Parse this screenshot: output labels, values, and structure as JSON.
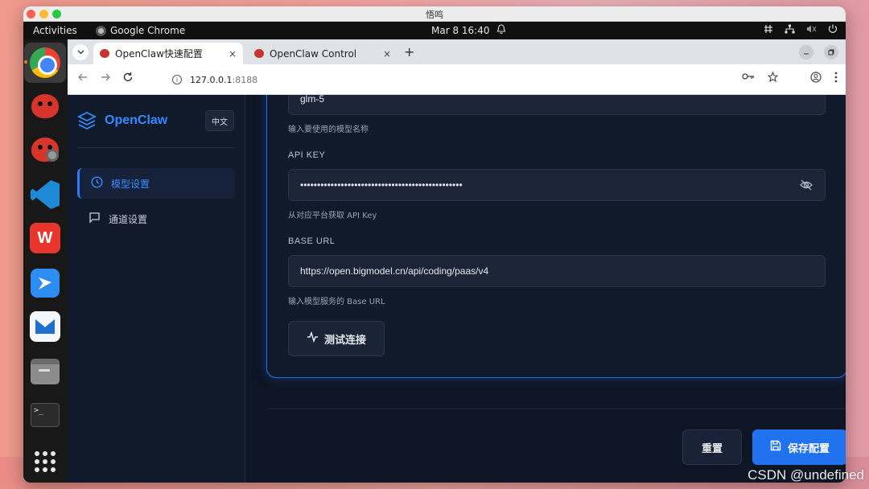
{
  "mac_window": {
    "title": "悟鸣"
  },
  "ubuntu_bar": {
    "activities": "Activities",
    "app_name": "Google Chrome",
    "clock": "Mar 8  16:40"
  },
  "dock": {
    "items": [
      "chrome-icon",
      "openclaw-bug-icon",
      "openclaw-bug-gear-icon",
      "vscode-icon",
      "wps-icon",
      "feishu-icon",
      "mail-icon",
      "files-icon",
      "terminal-icon",
      "show-apps-icon"
    ],
    "wps_letter": "W",
    "terminal_text": ">_"
  },
  "browser": {
    "tabs": [
      {
        "label": "OpenClaw快速配置",
        "active": true
      },
      {
        "label": "OpenClaw Control",
        "active": false
      }
    ],
    "new_tab": "+",
    "close_symbol": "×",
    "address": {
      "host": "127.0.0.1",
      "port": ":8188"
    }
  },
  "app": {
    "brand": "OpenClaw",
    "lang_button": "中文",
    "nav": [
      {
        "label": "模型设置",
        "active": true
      },
      {
        "label": "通道设置",
        "active": false
      }
    ],
    "form": {
      "model_value": "glm-5",
      "model_hint": "输入要使用的模型名称",
      "api_key_label": "API KEY",
      "api_key_value": "••••••••••••••••••••••••••••••••••••••••••••••••",
      "api_key_hint": "从对应平台获取 API Key",
      "base_url_label": "BASE URL",
      "base_url_value": "https://open.bigmodel.cn/api/coding/paas/v4",
      "base_url_hint": "输入模型服务的 Base URL",
      "test_button": "测试连接"
    },
    "reset_button": "重置",
    "save_button": "保存配置",
    "accent_color": "#2072ef"
  },
  "watermark": "CSDN @undefined"
}
